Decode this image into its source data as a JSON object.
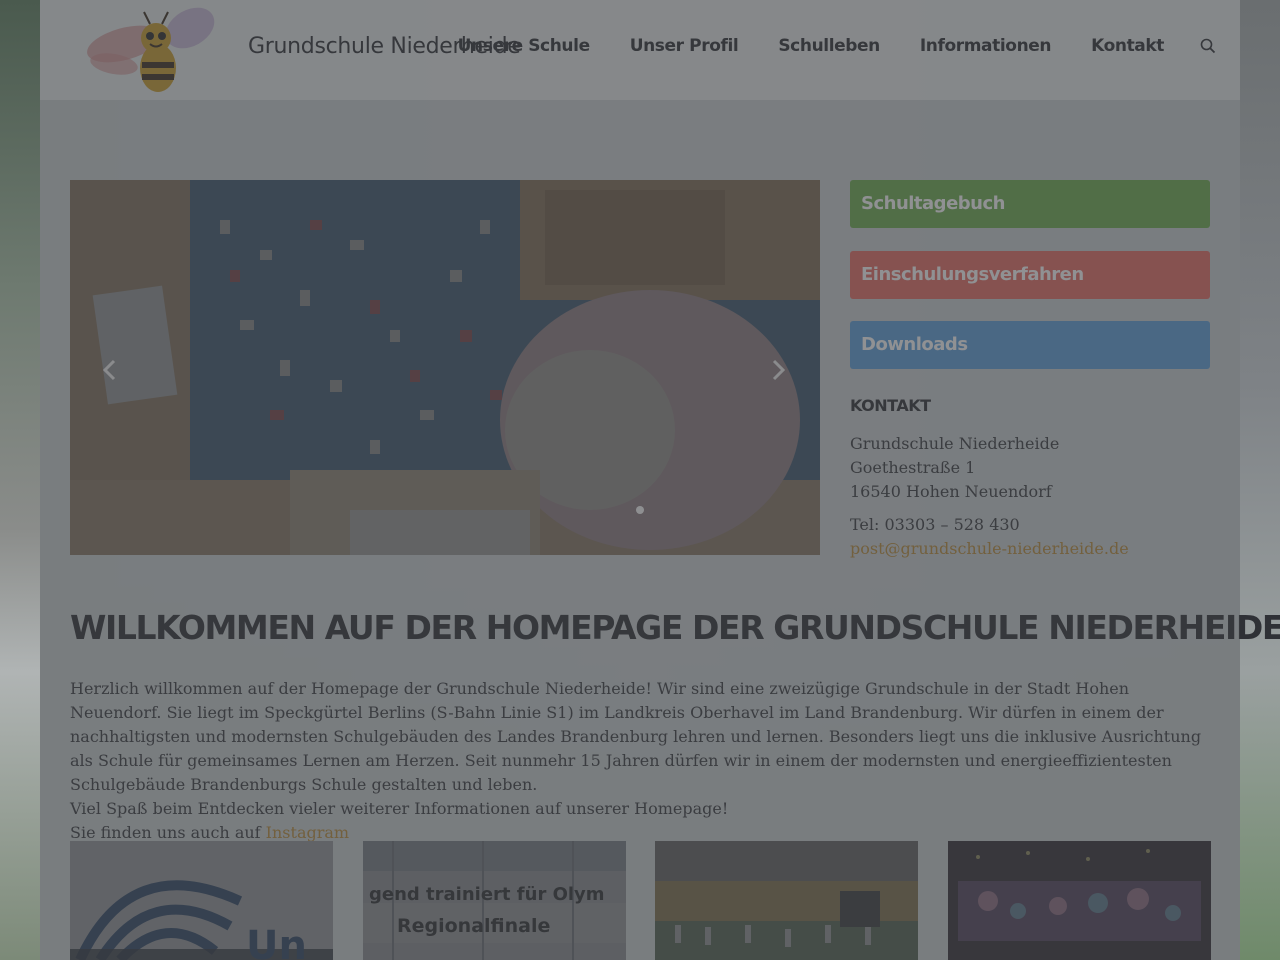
{
  "site": {
    "title": "Grundschule Niederheide",
    "logo_icon": "bee-mascot-icon"
  },
  "nav": {
    "items": [
      {
        "label": "Unsere Schule"
      },
      {
        "label": "Unser Profil"
      },
      {
        "label": "Schulleben"
      },
      {
        "label": "Informationen"
      },
      {
        "label": "Kontakt"
      }
    ],
    "search_icon": "search-icon"
  },
  "slider": {
    "image_alt": "",
    "prev_icon": "chevron-left-icon",
    "next_icon": "chevron-right-icon",
    "active_slide": 1,
    "slide_count": 1
  },
  "sidebar": {
    "buttons": [
      {
        "label": "Schultagebuch",
        "color": "#6aa84f"
      },
      {
        "label": "Einschulungsverfahren",
        "color": "#e16a63"
      },
      {
        "label": "Downloads",
        "color": "#5b9bd5"
      }
    ],
    "contact": {
      "title": "KONTAKT",
      "name": "Grundschule Niederheide",
      "street": "Goethestraße 1",
      "city": "16540 Hohen Neuendorf",
      "phone": "Tel: 03303 – 528 430",
      "email": "post@grundschule-niederheide.de"
    }
  },
  "main": {
    "headline": "WILLKOMMEN AUF DER HOMEPAGE DER GRUNDSCHULE NIEDERHEIDE",
    "paragraph_1": "Herzlich willkommen auf der Homepage der Grundschule Niederheide! Wir sind eine zweizügige Grundschule in der Stadt Hohen Neuendorf. Sie liegt im Speckgürtel Berlins (S-Bahn Linie S1) im Landkreis Oberhavel im Land Brandenburg. Wir dürfen in einem der nachhaltigsten und modernsten Schulgebäuden des Landes Brandenburg lehren und lernen. Besonders liegt uns die inklusive Ausrichtung als Schule für gemeinsames Lernen am Herzen. Seit nunmehr 15 Jahren dürfen wir in einem der modernsten und energieeffizientesten Schulgebäude Brandenburgs Schule gestalten und leben.",
    "paragraph_2": "Viel Spaß beim Entdecken vieler weiterer Informationen auf unserer Homepage!",
    "paragraph_3_prefix": "Sie finden uns auch auf ",
    "instagram_label": "Instagram"
  },
  "tiles": [
    {
      "caption": "Un"
    },
    {
      "caption_line1": "gend trainiert für Olym",
      "caption_line2": "Regionalfinale"
    },
    {
      "caption": ""
    },
    {
      "caption": ""
    }
  ],
  "colors": {
    "accent_link": "#b58a3a",
    "text_dark": "#2f3136"
  }
}
